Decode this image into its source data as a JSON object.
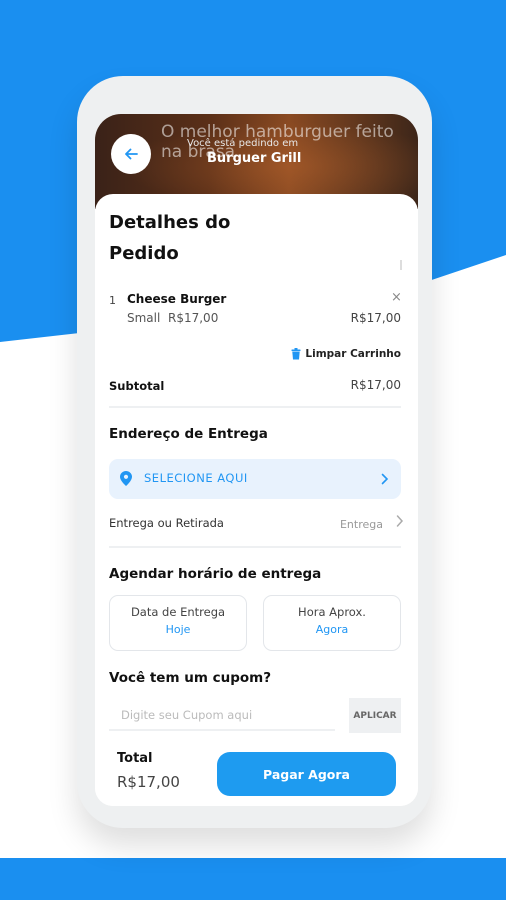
{
  "header": {
    "tagline": "O melhor hamburguer feito na brasa",
    "ordering_label": "Você está pedindo em",
    "restaurant_name": "Burguer Grill"
  },
  "order": {
    "title": "Detalhes do Pedido",
    "items": [
      {
        "qty": "1",
        "name": "Cheese Burger",
        "close_icon": "×",
        "size": "Small",
        "unit_price": "R$17,00",
        "total": "R$17,00"
      }
    ],
    "clear_cart_label": "Limpar Carrinho",
    "subtotal_label": "Subtotal",
    "subtotal_value": "R$17,00"
  },
  "delivery": {
    "section_title": "Endereço de Entrega",
    "address_button": "SELECIONE AQUI",
    "mode_label": "Entrega ou Retirada",
    "mode_value": "Entrega"
  },
  "schedule": {
    "section_title": "Agendar horário de entrega",
    "date_label": "Data de Entrega",
    "date_value": "Hoje",
    "time_label": "Hora Aprox.",
    "time_value": "Agora"
  },
  "coupon": {
    "section_title": "Você tem um cupom?",
    "placeholder": "Digite seu Cupom aqui",
    "apply_label": "APLICAR"
  },
  "footer": {
    "total_label": "Total",
    "total_value": "R$17,00",
    "pay_label": "Pagar Agora"
  },
  "colors": {
    "accent": "#1e9bf0",
    "background_blue": "#1a8ff0"
  },
  "icons": [
    "back-arrow-icon",
    "close-icon",
    "trash-icon",
    "location-pin-icon",
    "chevron-right-icon"
  ]
}
